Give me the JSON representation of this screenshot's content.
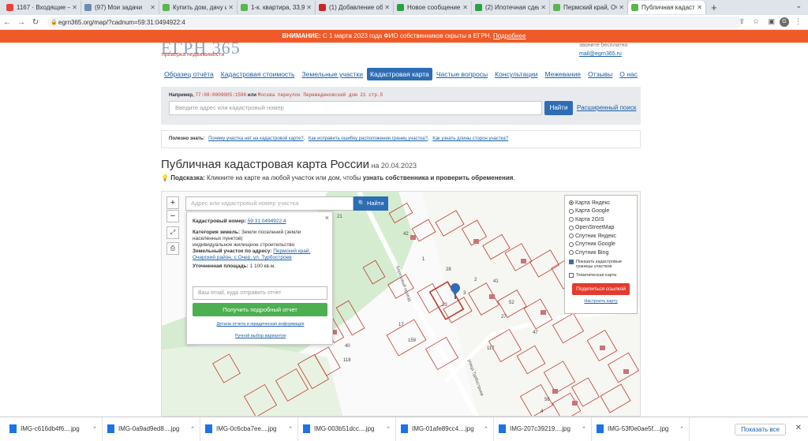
{
  "tabs": [
    {
      "title": "1167 · Входящие — ",
      "icon": "gmail-icon",
      "color": "#ea4335"
    },
    {
      "title": "(97) Мои задачи",
      "icon": "tasks-icon",
      "color": "#6a8caf"
    },
    {
      "title": "Купить дом, дачу и",
      "icon": "avito-icon",
      "color": "#5ab552"
    },
    {
      "title": "1-к. квартира, 33,9",
      "icon": "avito-icon",
      "color": "#5ab552"
    },
    {
      "title": "(1) Добавление объ",
      "icon": "doc-icon",
      "color": "#c62828"
    },
    {
      "title": "Новое сообщение",
      "icon": "whatsapp-icon",
      "color": "#25a244"
    },
    {
      "title": "(2) Ипотечная сдел",
      "icon": "whatsapp-icon",
      "color": "#25a244"
    },
    {
      "title": "Пермский край, Оч",
      "icon": "avito-icon",
      "color": "#5ab552"
    },
    {
      "title": "Публичная кадастр",
      "icon": "avito-icon",
      "color": "#5ab552",
      "active": true
    }
  ],
  "browser": {
    "url": "egrn365.org/map/?cadnum=59:31:0494922:4"
  },
  "banner": {
    "label": "ВНИМАНИЕ:",
    "text": " С 1 марта 2023 года ФИО собственников скрыты в ЕГРН. ",
    "link": "Подробнее"
  },
  "header": {
    "logo": "ЕГРН 365",
    "logo_sub": "проверка недвижимости",
    "call_free": "звоните бесплатно",
    "email": "mail@egrn365.ru"
  },
  "nav": [
    "Образец отчёта",
    "Кадастровая стоимость",
    "Земельные участки",
    "Кадастровая карта",
    "Частые вопросы",
    "Консультации",
    "Межевание",
    "Отзывы",
    "О нас"
  ],
  "search": {
    "example_label": "Например, ",
    "example_value1": "77:08:0009005:1596",
    "example_or": " или ",
    "example_value2": "Москва переулок Переведеновский дом 21 стр.5",
    "placeholder": "Введите адрес или кадастровый номер",
    "button": "Найти",
    "advanced": "Расширенный поиск"
  },
  "tips": {
    "label": "Полезно знать:",
    "links": [
      "Почему участка нет на кадастровой карте?",
      "Как исправить ошибку расположения границ участка?",
      "Как узнать длины сторон участка?"
    ]
  },
  "title": {
    "main": "Публичная кадастровая карта России",
    "date": " на 20.04.2023"
  },
  "hint": {
    "label": "Подсказка:",
    "text": " Кликните на карте на любой участок или дом, чтобы ",
    "bold": "узнать собственника и проверить обременения",
    "end": "."
  },
  "map": {
    "search_placeholder": "Адрес или кадастровый номер участка",
    "search_button": "Найти",
    "zoom_in": "+",
    "zoom_out": "−",
    "popup": {
      "cad_label": "Кадастровый номер:",
      "cad_value": "59:31:0494922:4",
      "category_label": "Категория земель:",
      "category_value": "Земли поселений (земли населенных пунктов)",
      "use_value": "индивидуальное жилищное строительство",
      "address_label": "Земельный участок по адресу:",
      "address_value": "Пермский край, Очерский район, с.Очер, ул. Турбостроев",
      "area_label": "Уточненная площадь:",
      "area_value": "1 100 кв.м.",
      "email_placeholder": "Ваш email, куда отправить отчет",
      "report_button": "Получить подробный отчет",
      "details_link": "Детали отчета и юридическая информация",
      "manual_link": "Ручной выбор вариантов"
    },
    "layers": [
      "Карта Яндекс",
      "Карта Google",
      "Карта 2GIS",
      "OpenStreetMap",
      "Спутник Яндекс",
      "Спутник Google",
      "Спутник Bing"
    ],
    "layer_selected": 0,
    "show_borders": "Показать кадастровые границы участков",
    "thematic": "Тематическая карта",
    "share_button": "Поделиться ссылкой",
    "settings_link": "Настроить карту",
    "parcel_labels": [
      "21",
      "42",
      "1",
      "2",
      "3",
      "41",
      "52",
      "159",
      "117",
      "118",
      "40",
      "23",
      "27",
      "47",
      "56",
      "4",
      "17",
      "28"
    ],
    "street_labels": [
      "Березовый проезд",
      "улица Турбостроев"
    ]
  },
  "downloads": {
    "items": [
      "IMG-c616db4f6....jpg",
      "IMG-0a9ad9ed8....jpg",
      "IMG-0c6cba7ee....jpg",
      "IMG-003b51dcc....jpg",
      "IMG-01afe89cc4....jpg",
      "IMG-207c39219....jpg",
      "IMG-53f0e0ae5f....jpg"
    ],
    "show_all": "Показать все"
  }
}
